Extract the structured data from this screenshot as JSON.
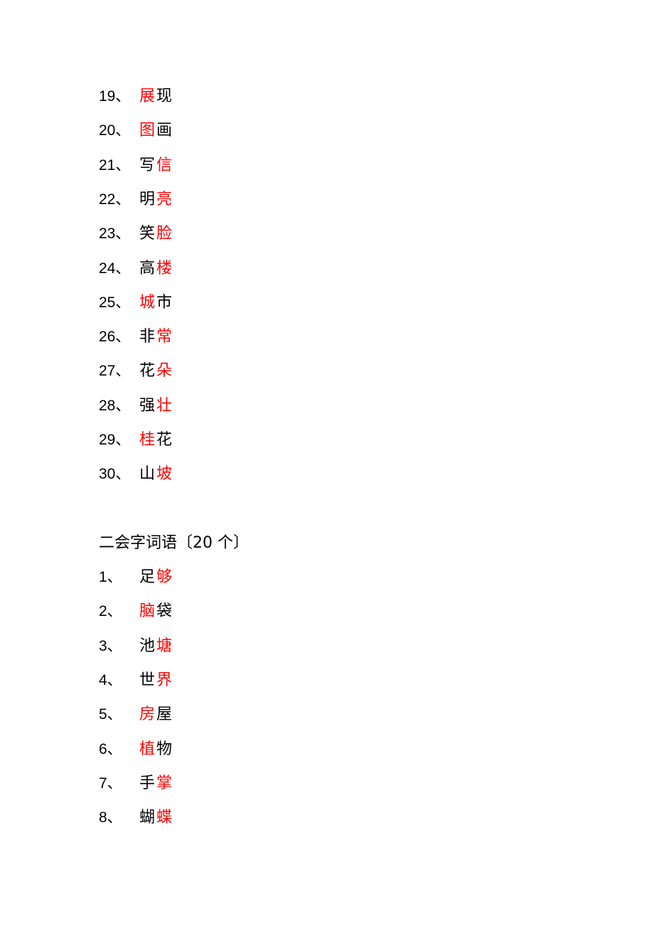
{
  "colors": {
    "highlight": "#ff0000",
    "text": "#000000"
  },
  "section1": {
    "items": [
      {
        "number": "19、",
        "chars": [
          {
            "c": "展",
            "red": true
          },
          {
            "c": "现",
            "red": false
          }
        ]
      },
      {
        "number": "20、",
        "chars": [
          {
            "c": "图",
            "red": true
          },
          {
            "c": "画",
            "red": false
          }
        ]
      },
      {
        "number": "21、",
        "chars": [
          {
            "c": "写",
            "red": false
          },
          {
            "c": "信",
            "red": true
          }
        ]
      },
      {
        "number": "22、",
        "chars": [
          {
            "c": "明",
            "red": false
          },
          {
            "c": "亮",
            "red": true
          }
        ]
      },
      {
        "number": "23、",
        "chars": [
          {
            "c": "笑",
            "red": false
          },
          {
            "c": "脸",
            "red": true
          }
        ]
      },
      {
        "number": "24、",
        "chars": [
          {
            "c": "高",
            "red": false
          },
          {
            "c": "楼",
            "red": true
          }
        ]
      },
      {
        "number": "25、",
        "chars": [
          {
            "c": "城",
            "red": true
          },
          {
            "c": "市",
            "red": false
          }
        ]
      },
      {
        "number": "26、",
        "chars": [
          {
            "c": "非",
            "red": false
          },
          {
            "c": "常",
            "red": true
          }
        ]
      },
      {
        "number": "27、",
        "chars": [
          {
            "c": "花",
            "red": false
          },
          {
            "c": "朵",
            "red": true
          }
        ]
      },
      {
        "number": "28、",
        "chars": [
          {
            "c": "强",
            "red": false
          },
          {
            "c": "壮",
            "red": true
          }
        ]
      },
      {
        "number": "29、",
        "chars": [
          {
            "c": "桂",
            "red": true
          },
          {
            "c": "花",
            "red": false
          }
        ]
      },
      {
        "number": "30、",
        "chars": [
          {
            "c": "山",
            "red": false
          },
          {
            "c": "坡",
            "red": true
          }
        ]
      }
    ]
  },
  "section2": {
    "heading": "二会字词语〔20 个〕",
    "items": [
      {
        "number": "1、",
        "chars": [
          {
            "c": "足",
            "red": false
          },
          {
            "c": "够",
            "red": true
          }
        ]
      },
      {
        "number": "2、",
        "chars": [
          {
            "c": "脑",
            "red": true
          },
          {
            "c": "袋",
            "red": false
          }
        ]
      },
      {
        "number": "3、",
        "chars": [
          {
            "c": "池",
            "red": false
          },
          {
            "c": "塘",
            "red": true
          }
        ]
      },
      {
        "number": "4、",
        "chars": [
          {
            "c": "世",
            "red": false
          },
          {
            "c": "界",
            "red": true
          }
        ]
      },
      {
        "number": "5、",
        "chars": [
          {
            "c": "房",
            "red": true
          },
          {
            "c": "屋",
            "red": false
          }
        ]
      },
      {
        "number": "6、",
        "chars": [
          {
            "c": "植",
            "red": true
          },
          {
            "c": "物",
            "red": false
          }
        ]
      },
      {
        "number": "7、",
        "chars": [
          {
            "c": "手",
            "red": false
          },
          {
            "c": "掌",
            "red": true
          }
        ]
      },
      {
        "number": "8、",
        "chars": [
          {
            "c": "蝴",
            "red": false
          },
          {
            "c": "蝶",
            "red": true
          }
        ]
      }
    ]
  }
}
